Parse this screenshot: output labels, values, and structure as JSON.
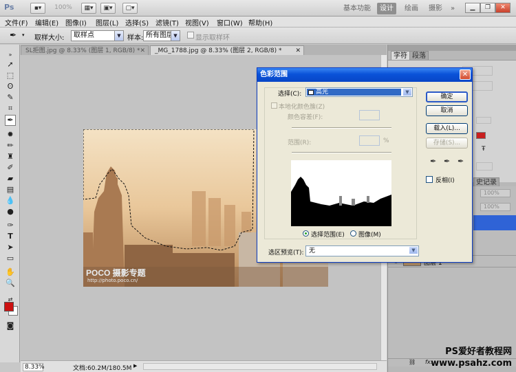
{
  "app": {
    "logo": "Ps",
    "zoom_display": "100%",
    "workspaces": [
      "基本功能",
      "设计",
      "绘画",
      "摄影"
    ],
    "active_workspace": "设计"
  },
  "menu": [
    "文件(F)",
    "编辑(E)",
    "图像(I)",
    "图层(L)",
    "选择(S)",
    "滤镜(T)",
    "视图(V)",
    "窗口(W)",
    "帮助(H)"
  ],
  "options": {
    "sample_size_label": "取样大小:",
    "sample_size_value": "取样点",
    "sample_label": "样本:",
    "sample_value": "所有图层",
    "show_ring_label": "显示取样环"
  },
  "tabs": [
    {
      "label": "SL拒图.jpg @ 8.33% (图层 1, RGB/8) *",
      "active": false
    },
    {
      "label": "_MG_1788.jpg @ 8.33% (图层 2, RGB/8) *",
      "active": true
    }
  ],
  "photo_watermark": {
    "brand": "POCO 摄影专题",
    "url": "http://photo.poco.cn/"
  },
  "status": {
    "zoom": "8.33%",
    "doc_size": "文档:60.2M/180.5M"
  },
  "panels": {
    "tab_char": "字符",
    "tab_para": "段落",
    "history_tab": "史记录",
    "opacity": "100%",
    "fill": "100%",
    "layer_name": "图层 1"
  },
  "dialog": {
    "title": "色彩范围",
    "select_label": "选择(C):",
    "select_value": "高光",
    "localized_label": "本地化颜色簇(Z)",
    "fuzziness_label": "颜色容差(F):",
    "range_label": "范围(R):",
    "range_unit": "%",
    "ok": "确定",
    "cancel": "取消",
    "load": "载入(L)...",
    "save": "存储(S)...",
    "invert": "反相(I)",
    "radio_selection": "选择范围(E)",
    "radio_image": "图像(M)",
    "preview_label": "选区预览(T):",
    "preview_value": "无"
  },
  "page_watermark": {
    "line1": "PS爱好者教程网",
    "line2": "www.psahz.com"
  },
  "colors": {
    "foreground": "#cc1111",
    "dialog_title": "#0a52d8",
    "dialog_bg": "#ece9d8"
  }
}
